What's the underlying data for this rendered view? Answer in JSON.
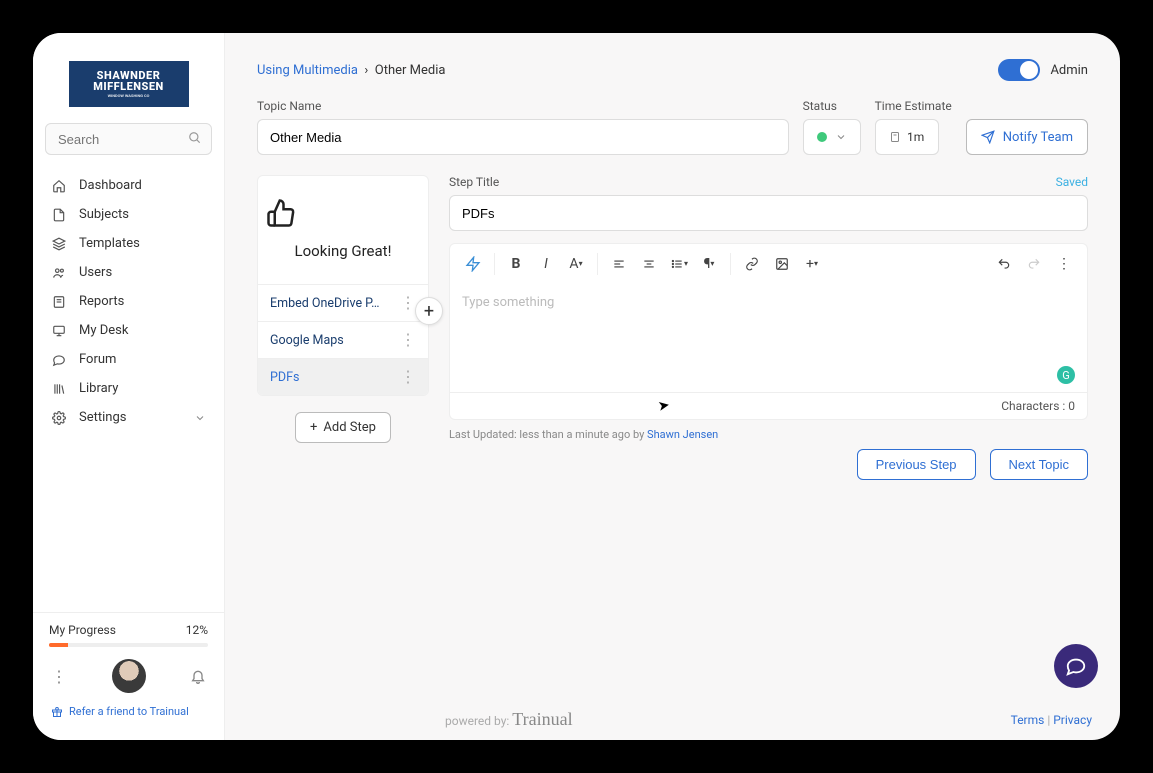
{
  "logo": {
    "line1": "SHAWNDER",
    "line2": "MIFFLENSEN",
    "tag": "WINDOW WASHING CO"
  },
  "search": {
    "placeholder": "Search"
  },
  "nav": {
    "dashboard": "Dashboard",
    "subjects": "Subjects",
    "templates": "Templates",
    "users": "Users",
    "reports": "Reports",
    "mydesk": "My Desk",
    "forum": "Forum",
    "library": "Library",
    "settings": "Settings"
  },
  "progress": {
    "label": "My Progress",
    "value": "12%"
  },
  "refer": "Refer a friend to Trainual",
  "breadcrumb": {
    "parent": "Using Multimedia",
    "current": "Other Media"
  },
  "admin_label": "Admin",
  "meta": {
    "topic_label": "Topic Name",
    "topic_value": "Other Media",
    "status_label": "Status",
    "time_label": "Time Estimate",
    "time_value": "1m",
    "notify_label": "Notify Team"
  },
  "pitch": "Looking Great!",
  "steps": {
    "s1": "Embed OneDrive P…",
    "s2": "Google Maps",
    "s3": "PDFs"
  },
  "add_step": "Add Step",
  "editor": {
    "step_title_label": "Step Title",
    "saved": "Saved",
    "step_title_value": "PDFs",
    "placeholder": "Type something",
    "char_label": "Characters : 0",
    "last_updated_prefix": "Last Updated: less than a minute ago by ",
    "last_updated_user": "Shawn Jensen"
  },
  "nav_buttons": {
    "prev": "Previous Step",
    "next": "Next Topic"
  },
  "footer": {
    "powered": "powered by:",
    "brand": "Trainual",
    "terms": "Terms",
    "privacy": "Privacy"
  }
}
